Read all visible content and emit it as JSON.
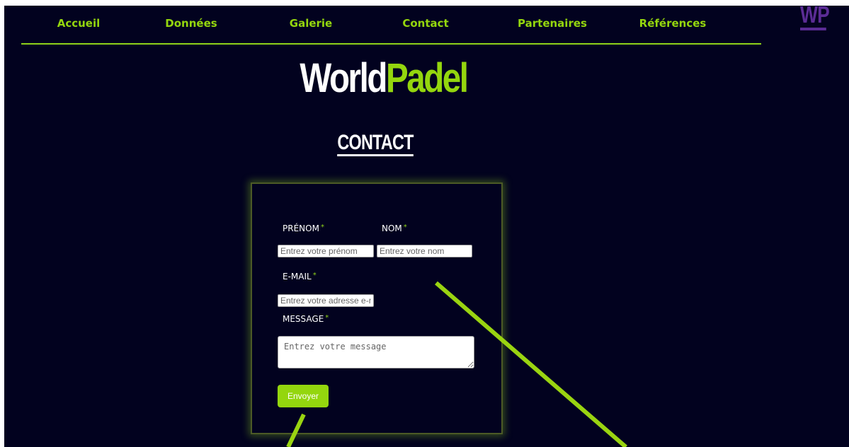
{
  "nav": {
    "items": [
      {
        "label": "Accueil"
      },
      {
        "label": "Données"
      },
      {
        "label": "Galerie"
      },
      {
        "label": "Contact"
      },
      {
        "label": "Partenaires"
      },
      {
        "label": "Références"
      }
    ],
    "logo_text": "WP"
  },
  "brand": {
    "part1": "World",
    "part2": "Padel"
  },
  "page_title": "CONTACT",
  "form": {
    "firstname": {
      "label": "PRÉNOM",
      "placeholder": "Entrez votre prénom"
    },
    "lastname": {
      "label": "NOM",
      "placeholder": "Entrez votre nom"
    },
    "email": {
      "label": "E-MAIL",
      "placeholder": "Entrez votre adresse e-mail"
    },
    "message": {
      "label": "MESSAGE",
      "placeholder": "Entrez votre message"
    },
    "required_mark": "*",
    "submit_label": "Envoyer"
  },
  "colors": {
    "background": "#02021f",
    "accent": "#94d60e",
    "logo_purple": "#5b2c95"
  }
}
